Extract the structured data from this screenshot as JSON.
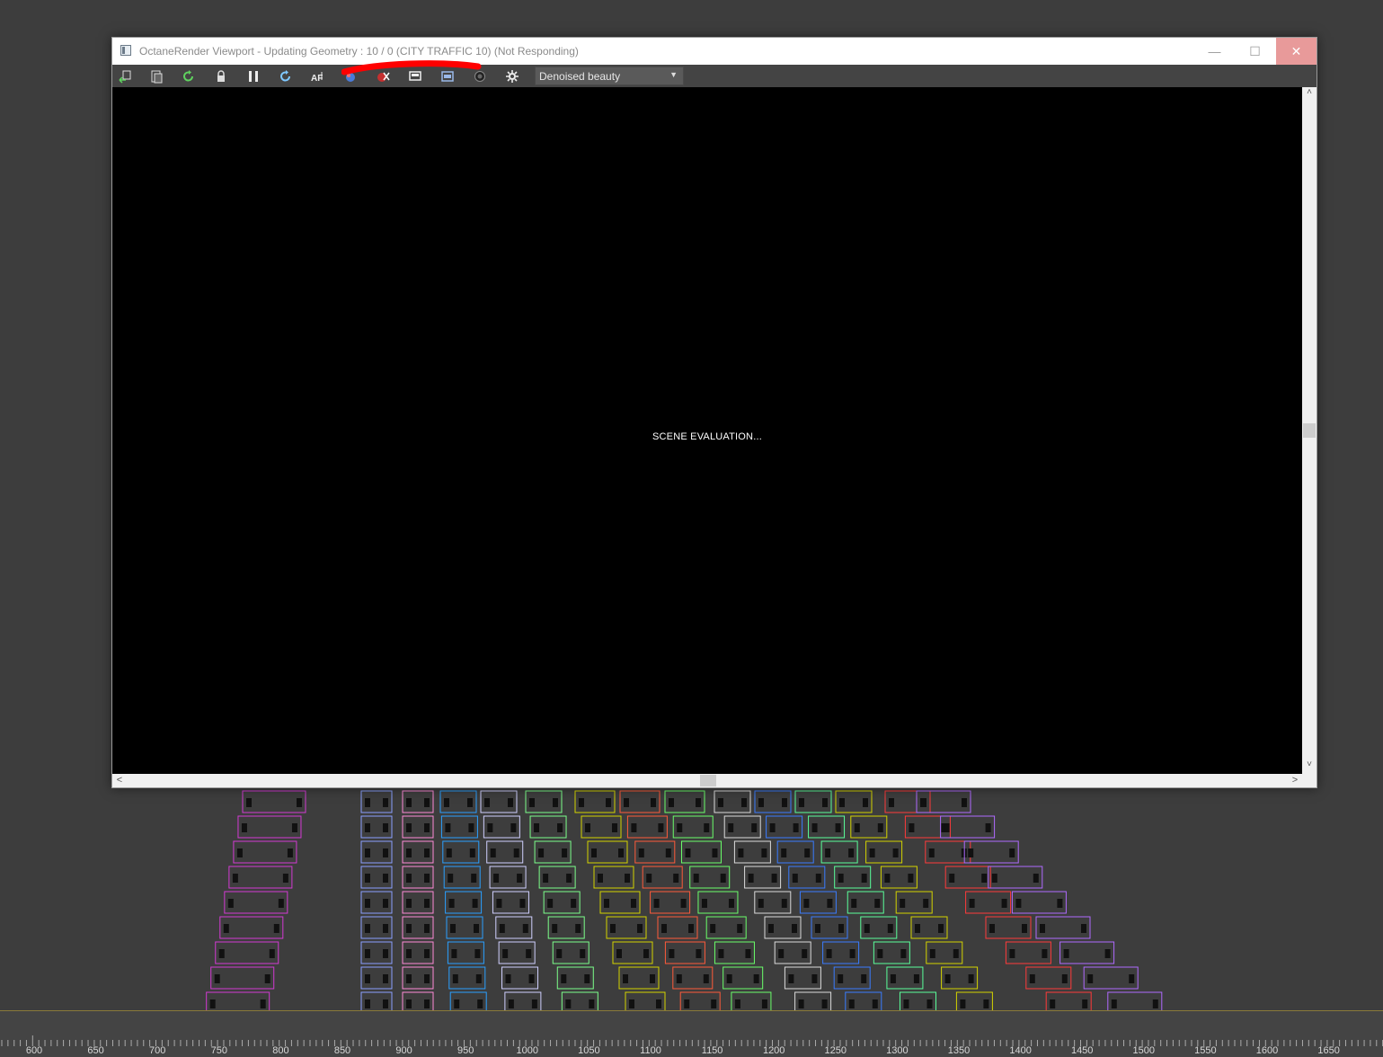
{
  "window": {
    "title": "OctaneRender Viewport - Updating Geometry : 10 / 0 (CITY TRAFFIC 10) (Not Responding)",
    "minimize_glyph": "—",
    "maximize_glyph": "☐",
    "close_glyph": "✕"
  },
  "toolbar": {
    "buttons": [
      {
        "name": "send-scene-icon"
      },
      {
        "name": "copy-clipboard-icon"
      },
      {
        "name": "restart-render-icon"
      },
      {
        "name": "lock-viewport-icon"
      },
      {
        "name": "pause-render-icon"
      },
      {
        "name": "refresh-icon"
      },
      {
        "name": "autofocus-icon"
      },
      {
        "name": "color-picker-icon"
      },
      {
        "name": "material-picker-icon"
      },
      {
        "name": "region-render-icon"
      },
      {
        "name": "film-region-icon"
      },
      {
        "name": "camera-icon"
      },
      {
        "name": "settings-icon"
      }
    ],
    "passes_value": "Denoised beauty"
  },
  "render": {
    "status": "SCENE EVALUATION..."
  },
  "timeline": {
    "labels": [
      "600",
      "650",
      "700",
      "750",
      "800",
      "850",
      "900",
      "950",
      "1000",
      "1050",
      "1100",
      "1150",
      "1200",
      "1250",
      "1300",
      "1350",
      "1400",
      "1450",
      "1500",
      "1550",
      "1600",
      "1650"
    ]
  },
  "colors": {
    "background": "#3d3d3d",
    "render_bg": "#000000",
    "redaction": "#ff0000",
    "close_hover": "#e89a9a"
  }
}
